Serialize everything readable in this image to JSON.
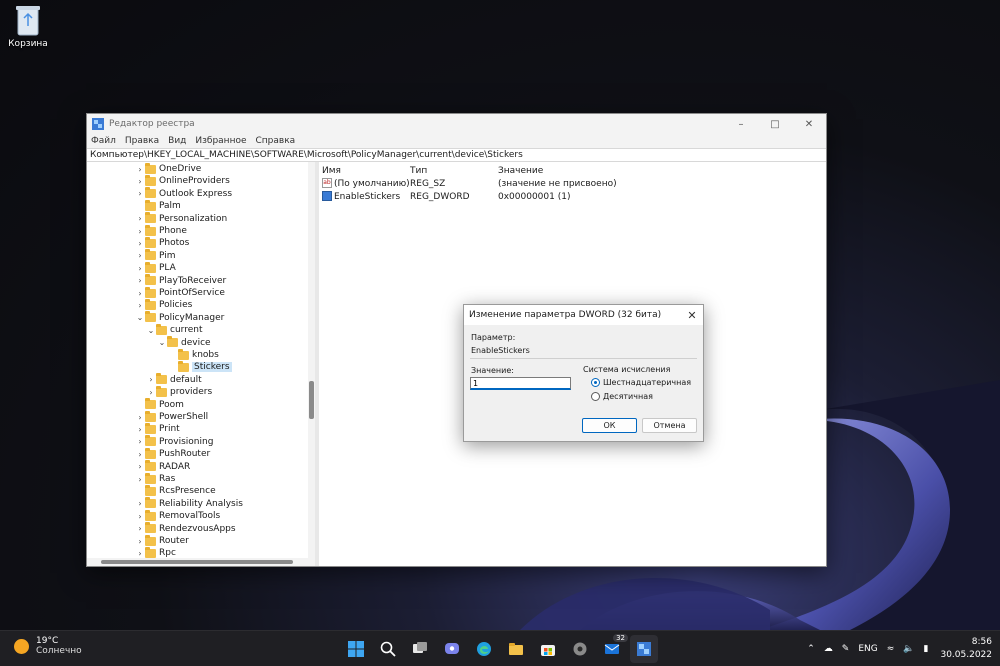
{
  "desktop": {
    "recycle_bin_label": "Корзина"
  },
  "window": {
    "title": "Редактор реестра",
    "menu": [
      "Файл",
      "Правка",
      "Вид",
      "Избранное",
      "Справка"
    ],
    "address": "Компьютер\\HKEY_LOCAL_MACHINE\\SOFTWARE\\Microsoft\\PolicyManager\\current\\device\\Stickers",
    "tree": [
      {
        "label": "OneDrive",
        "depth": 0,
        "exp": "closed"
      },
      {
        "label": "OnlineProviders",
        "depth": 0,
        "exp": "closed"
      },
      {
        "label": "Outlook Express",
        "depth": 0,
        "exp": "closed"
      },
      {
        "label": "Palm",
        "depth": 0,
        "exp": "none"
      },
      {
        "label": "Personalization",
        "depth": 0,
        "exp": "closed"
      },
      {
        "label": "Phone",
        "depth": 0,
        "exp": "closed"
      },
      {
        "label": "Photos",
        "depth": 0,
        "exp": "closed"
      },
      {
        "label": "Pim",
        "depth": 0,
        "exp": "closed"
      },
      {
        "label": "PLA",
        "depth": 0,
        "exp": "closed"
      },
      {
        "label": "PlayToReceiver",
        "depth": 0,
        "exp": "closed"
      },
      {
        "label": "PointOfService",
        "depth": 0,
        "exp": "closed"
      },
      {
        "label": "Policies",
        "depth": 0,
        "exp": "closed"
      },
      {
        "label": "PolicyManager",
        "depth": 0,
        "exp": "open"
      },
      {
        "label": "current",
        "depth": 1,
        "exp": "open"
      },
      {
        "label": "device",
        "depth": 2,
        "exp": "open"
      },
      {
        "label": "knobs",
        "depth": 3,
        "exp": "none"
      },
      {
        "label": "Stickers",
        "depth": 3,
        "exp": "none",
        "selected": true
      },
      {
        "label": "default",
        "depth": 1,
        "exp": "closed"
      },
      {
        "label": "providers",
        "depth": 1,
        "exp": "closed"
      },
      {
        "label": "Poom",
        "depth": 0,
        "exp": "none"
      },
      {
        "label": "PowerShell",
        "depth": 0,
        "exp": "closed"
      },
      {
        "label": "Print",
        "depth": 0,
        "exp": "closed"
      },
      {
        "label": "Provisioning",
        "depth": 0,
        "exp": "closed"
      },
      {
        "label": "PushRouter",
        "depth": 0,
        "exp": "closed"
      },
      {
        "label": "RADAR",
        "depth": 0,
        "exp": "closed"
      },
      {
        "label": "Ras",
        "depth": 0,
        "exp": "closed"
      },
      {
        "label": "RcsPresence",
        "depth": 0,
        "exp": "none"
      },
      {
        "label": "Reliability Analysis",
        "depth": 0,
        "exp": "closed"
      },
      {
        "label": "RemovalTools",
        "depth": 0,
        "exp": "closed"
      },
      {
        "label": "RendezvousApps",
        "depth": 0,
        "exp": "closed"
      },
      {
        "label": "Router",
        "depth": 0,
        "exp": "closed"
      },
      {
        "label": "Rpc",
        "depth": 0,
        "exp": "closed"
      }
    ],
    "columns": {
      "name": "Имя",
      "type": "Тип",
      "value": "Значение"
    },
    "rows": [
      {
        "icon": "string-value-icon",
        "name": "(По умолчанию)",
        "type": "REG_SZ",
        "value": "(значение не присвоено)"
      },
      {
        "icon": "dword-value-icon",
        "name": "EnableStickers",
        "type": "REG_DWORD",
        "value": "0x00000001 (1)"
      }
    ]
  },
  "dialog": {
    "title": "Изменение параметра DWORD (32 бита)",
    "param_label": "Параметр:",
    "param_value": "EnableStickers",
    "value_label": "Значение:",
    "value_input": "1",
    "base_label": "Система исчисления",
    "hex_label": "Шестнадцатеричная",
    "dec_label": "Десятичная",
    "selected_base": "hex",
    "ok": "ОК",
    "cancel": "Отмена"
  },
  "taskbar": {
    "weather_temp": "19°C",
    "weather_desc": "Солнечно",
    "icons": [
      "start-icon",
      "search-icon",
      "task-view-icon",
      "chat-icon",
      "edge-icon",
      "explorer-icon",
      "store-icon",
      "settings-icon",
      "mail-icon",
      "regedit-icon"
    ],
    "mail_badge": "32",
    "language": "ENG",
    "time": "8:56",
    "date": "30.05.2022"
  }
}
